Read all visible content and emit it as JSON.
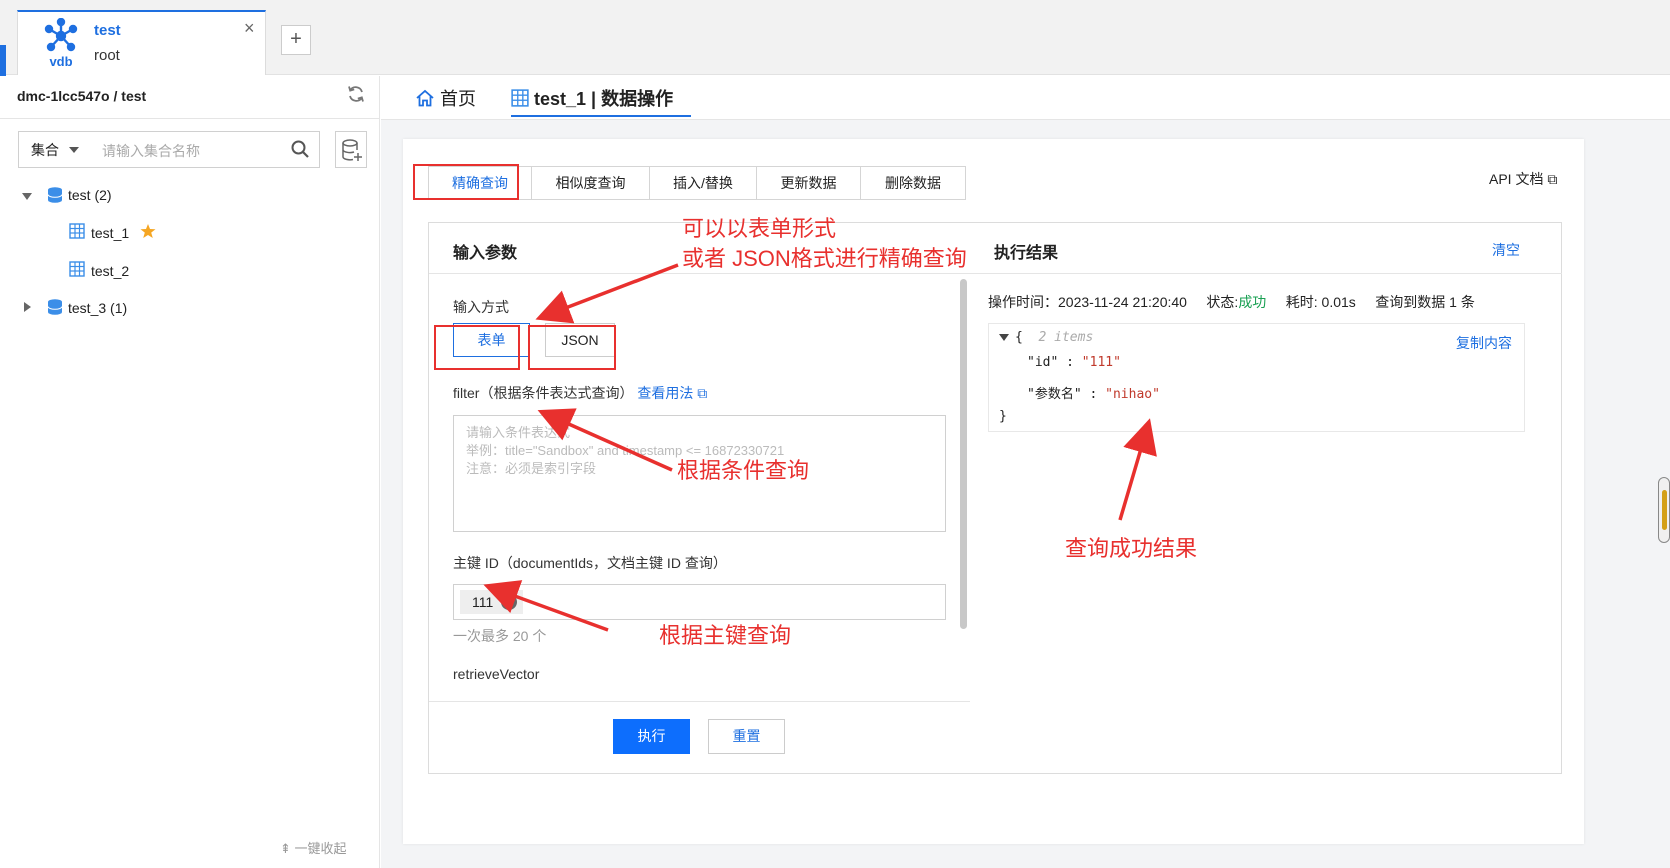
{
  "connection_tab": {
    "logo_text": "vdb",
    "name": "test",
    "user": "root",
    "close_symbol": "×",
    "add_symbol": "+"
  },
  "sidebar": {
    "title": "dmc-1lcc547o / test",
    "select_value": "集合",
    "search_placeholder": "请输入集合名称",
    "tree": [
      {
        "label": "test (2)",
        "expanded": true,
        "children": [
          {
            "label": "test_1",
            "starred": true
          },
          {
            "label": "test_2",
            "starred": false
          }
        ]
      },
      {
        "label": "test_3 (1)",
        "expanded": false,
        "children": []
      }
    ],
    "collapse_all": "一键收起"
  },
  "main_tabs": [
    {
      "label": "首页",
      "icon": "home-icon"
    },
    {
      "label": "test_1 | 数据操作",
      "icon": "table-icon",
      "active": true
    }
  ],
  "sub_tabs": [
    "精确查询",
    "相似度查询",
    "插入/替换",
    "更新数据",
    "删除数据"
  ],
  "api_doc": "API 文档",
  "input_panel": {
    "title": "输入参数",
    "mode_label": "输入方式",
    "modes": [
      "表单",
      "JSON"
    ],
    "filter_label": "filter（根据条件表达式查询）",
    "filter_link": "查看用法",
    "filter_placeholder": [
      "请输入条件表达式",
      "举例：title=\"Sandbox\" and timestamp <= 16872330721",
      "注意：必须是索引字段"
    ],
    "pk_label": "主键 ID（documentIds，文档主键 ID 查询）",
    "pk_tag": "111",
    "pk_hint": "一次最多 20 个",
    "retrieve_label": "retrieveVector",
    "execute": "执行",
    "reset": "重置"
  },
  "result_panel": {
    "title": "执行结果",
    "clear": "清空",
    "op_time_label": "操作时间：",
    "op_time": "2023-11-24 21:20:40",
    "status_label": "状态:",
    "status": "成功",
    "cost_label": "耗时:",
    "cost": "0.01s",
    "count_text": "查询到数据 1 条",
    "copy": "复制内容",
    "json": {
      "open": "{",
      "count": "2 items",
      "lines": [
        {
          "key": "\"id\"",
          "value": "\"111\""
        },
        {
          "key": "\"参数名\"",
          "value": "\"nihao\""
        }
      ],
      "close": "}"
    }
  },
  "annotations": {
    "form_json": [
      "可以以表单形式",
      "或者 JSON格式进行精确查询"
    ],
    "filter": "根据条件查询",
    "pk": "根据主键查询",
    "result": "查询成功结果",
    "color": "#e8302e"
  },
  "colors": {
    "accent": "#1e6fe0",
    "primary_button": "#0d6efd",
    "success": "#1aa053"
  }
}
